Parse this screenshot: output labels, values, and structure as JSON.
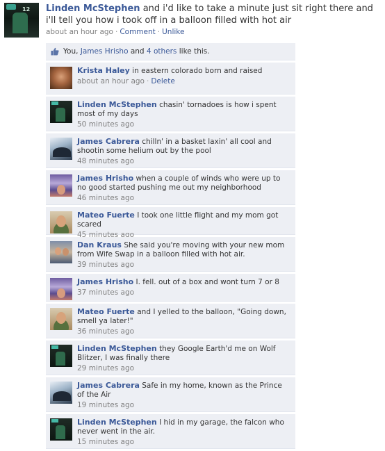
{
  "post": {
    "author": "Linden McStephen",
    "text": " and i'd like to take a minute just sit right there and i'll tell you how i took off in a balloon filled with hot air",
    "time": "about an hour ago",
    "comment_link": "Comment",
    "unlike_link": "Unlike",
    "avatar_number": "12"
  },
  "likes": {
    "prefix": "You, ",
    "person": "James Hrisho",
    "middle": " and ",
    "others": "4 others",
    "suffix": " like this."
  },
  "comments": [
    {
      "author": "Krista Haley",
      "text": "in eastern colorado born and raised",
      "time": "about an hour ago",
      "delete": "Delete",
      "avatar": "krista"
    },
    {
      "author": "Linden McStephen",
      "text": "chasin' tornadoes is how i spent most of my days",
      "time": "50 minutes ago",
      "avatar": "linden"
    },
    {
      "author": "James Cabrera",
      "text": "chilln' in a basket laxin' all cool and shootin some helium out by the pool",
      "time": "48 minutes ago",
      "avatar": "cabrera"
    },
    {
      "author": "James Hrisho",
      "text": "when a couple of winds who were up to no good started pushing me out my neighborhood",
      "time": "46 minutes ago",
      "avatar": "hrisho"
    },
    {
      "author": "Mateo Fuerte",
      "text": "I took one little flight and my mom got scared",
      "time": "45 minutes ago",
      "avatar": "mateo"
    },
    {
      "author": "Dan Kraus",
      "text": "She said you're moving with your new mom from Wife Swap in a balloon filled with hot air.",
      "time": "39 minutes ago",
      "avatar": "dan"
    },
    {
      "author": "James Hrisho",
      "text": "I. fell. out of a box and wont turn 7 or 8",
      "time": "37 minutes ago",
      "avatar": "hrisho"
    },
    {
      "author": "Mateo Fuerte",
      "text": "and I yelled to the balloon, \"Going down, smell ya later!\"",
      "time": "36 minutes ago",
      "avatar": "mateo"
    },
    {
      "author": "Linden McStephen",
      "text": "they Google Earth'd me on Wolf Blitzer, I was finally there",
      "time": "29 minutes ago",
      "avatar": "linden"
    },
    {
      "author": "James Cabrera",
      "text": "Safe in my home, known as the Prince of the Air",
      "time": "19 minutes ago",
      "avatar": "cabrera"
    },
    {
      "author": "Linden McStephen",
      "text": "I hid in my garage, the falcon who never went in the air.",
      "time": "15 minutes ago",
      "avatar": "linden"
    }
  ],
  "colors": {
    "link": "#3b5998",
    "comment_bg": "#edeff4",
    "meta": "#808080"
  }
}
